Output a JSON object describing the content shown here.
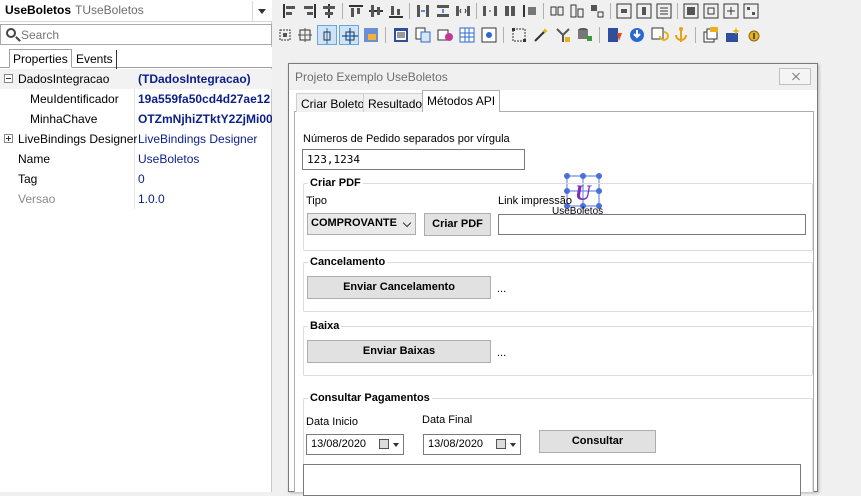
{
  "inspector": {
    "object_name": "UseBoletos",
    "object_type": "TUseBoletos",
    "search_placeholder": "Search",
    "tabs": [
      "Properties",
      "Events"
    ],
    "properties": [
      {
        "name": "DadosIntegracao",
        "value": "(TDadosIntegracao)",
        "expander": "minus",
        "value_style": "bold"
      },
      {
        "name": "MeuIdentificador",
        "value": "19a559fa50cd4d27ae12",
        "sub": true,
        "value_style": "bold"
      },
      {
        "name": "MinhaChave",
        "value": "OTZmNjhiZTktY2ZjMi00",
        "sub": true,
        "value_style": "bold"
      },
      {
        "name": "LiveBindings Designer",
        "value": "LiveBindings Designer",
        "expander": "plus"
      },
      {
        "name": "Name",
        "value": "UseBoletos"
      },
      {
        "name": "Tag",
        "value": "0"
      },
      {
        "name": "Versao",
        "value": "1.0.0",
        "disabled": true
      }
    ]
  },
  "form": {
    "title": "Projeto Exemplo UseBoletos",
    "tabs": [
      "Criar Boleto",
      "Resultado",
      "Métodos API"
    ],
    "active_tab": "Métodos API",
    "pedido_label": "Números de Pedido separados por vírgula",
    "pedido_value": "123,1234",
    "component_caption": "UseBoletos",
    "criar_pdf": {
      "title": "Criar PDF",
      "tipo_label": "Tipo",
      "tipo_value": "COMPROVANTE",
      "button": "Criar PDF",
      "link_label": "Link impressão",
      "link_value": ""
    },
    "cancelamento": {
      "title": "Cancelamento",
      "button": "Enviar Cancelamento",
      "status": "..."
    },
    "baixa": {
      "title": "Baixa",
      "button": "Enviar Baixas",
      "status": "..."
    },
    "consultar": {
      "title": "Consultar Pagamentos",
      "inicio_label": "Data Inicio",
      "inicio_value": "13/08/2020",
      "final_label": "Data Final",
      "final_value": "13/08/2020",
      "button": "Consultar"
    }
  },
  "colors": {
    "property_value": "#0b1e89",
    "component_logo": "#4a6fd8"
  }
}
